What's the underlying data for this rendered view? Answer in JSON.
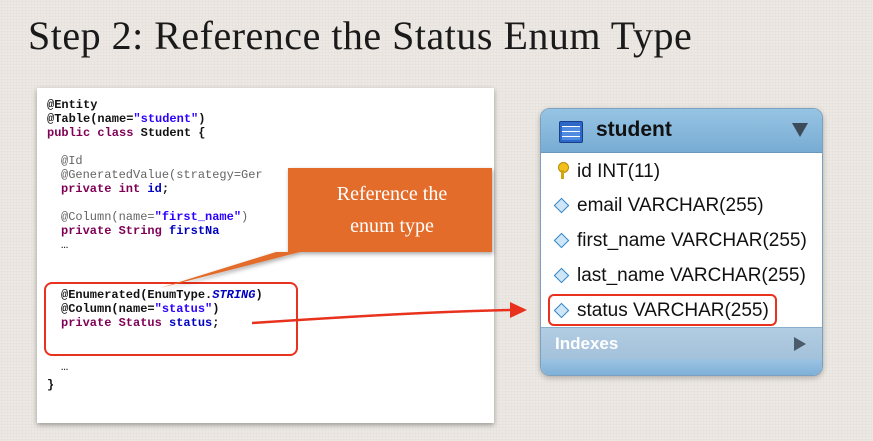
{
  "slide": {
    "title": "Step 2: Reference the Status Enum Type"
  },
  "code": {
    "entity": "@Entity",
    "table_prefix": "@Table(name=",
    "table_name": "\"student\"",
    "table_suffix": ")",
    "class_kw": "public class",
    "class_rest": " Student {",
    "id_ann": "@Id",
    "genval": "@GeneratedValue(strategy=Ger",
    "private_int": "private int",
    "id_field": " id",
    "semicolon": ";",
    "col_prefix": "@Column(name=",
    "first_name_str": "\"first_name\"",
    "close_paren": ")",
    "private_string": "private String",
    "first_name_field": " firstNa",
    "ellipsis1": "…",
    "enumerated_prefix": "@Enumerated(EnumType.",
    "enumerated_value": "STRING",
    "status_str": "\"status\"",
    "private_status": "private Status",
    "status_field": " status",
    "ellipsis2": "…",
    "close_brace": "}"
  },
  "callout": {
    "line1": "Reference the",
    "line2": "enum type",
    "color": "#e46c2b"
  },
  "db_table": {
    "name": "student",
    "columns": [
      {
        "label": "id INT(11)",
        "icon": "key-icon"
      },
      {
        "label": "email VARCHAR(255)",
        "icon": "diamond-icon"
      },
      {
        "label": "first_name VARCHAR(255)",
        "icon": "diamond-icon"
      },
      {
        "label": "last_name VARCHAR(255)",
        "icon": "diamond-icon"
      },
      {
        "label": "status VARCHAR(255)",
        "icon": "diamond-icon"
      }
    ],
    "indexes_label": "Indexes",
    "header_color": "#86b7dd"
  },
  "accent_red": "#e8321e"
}
